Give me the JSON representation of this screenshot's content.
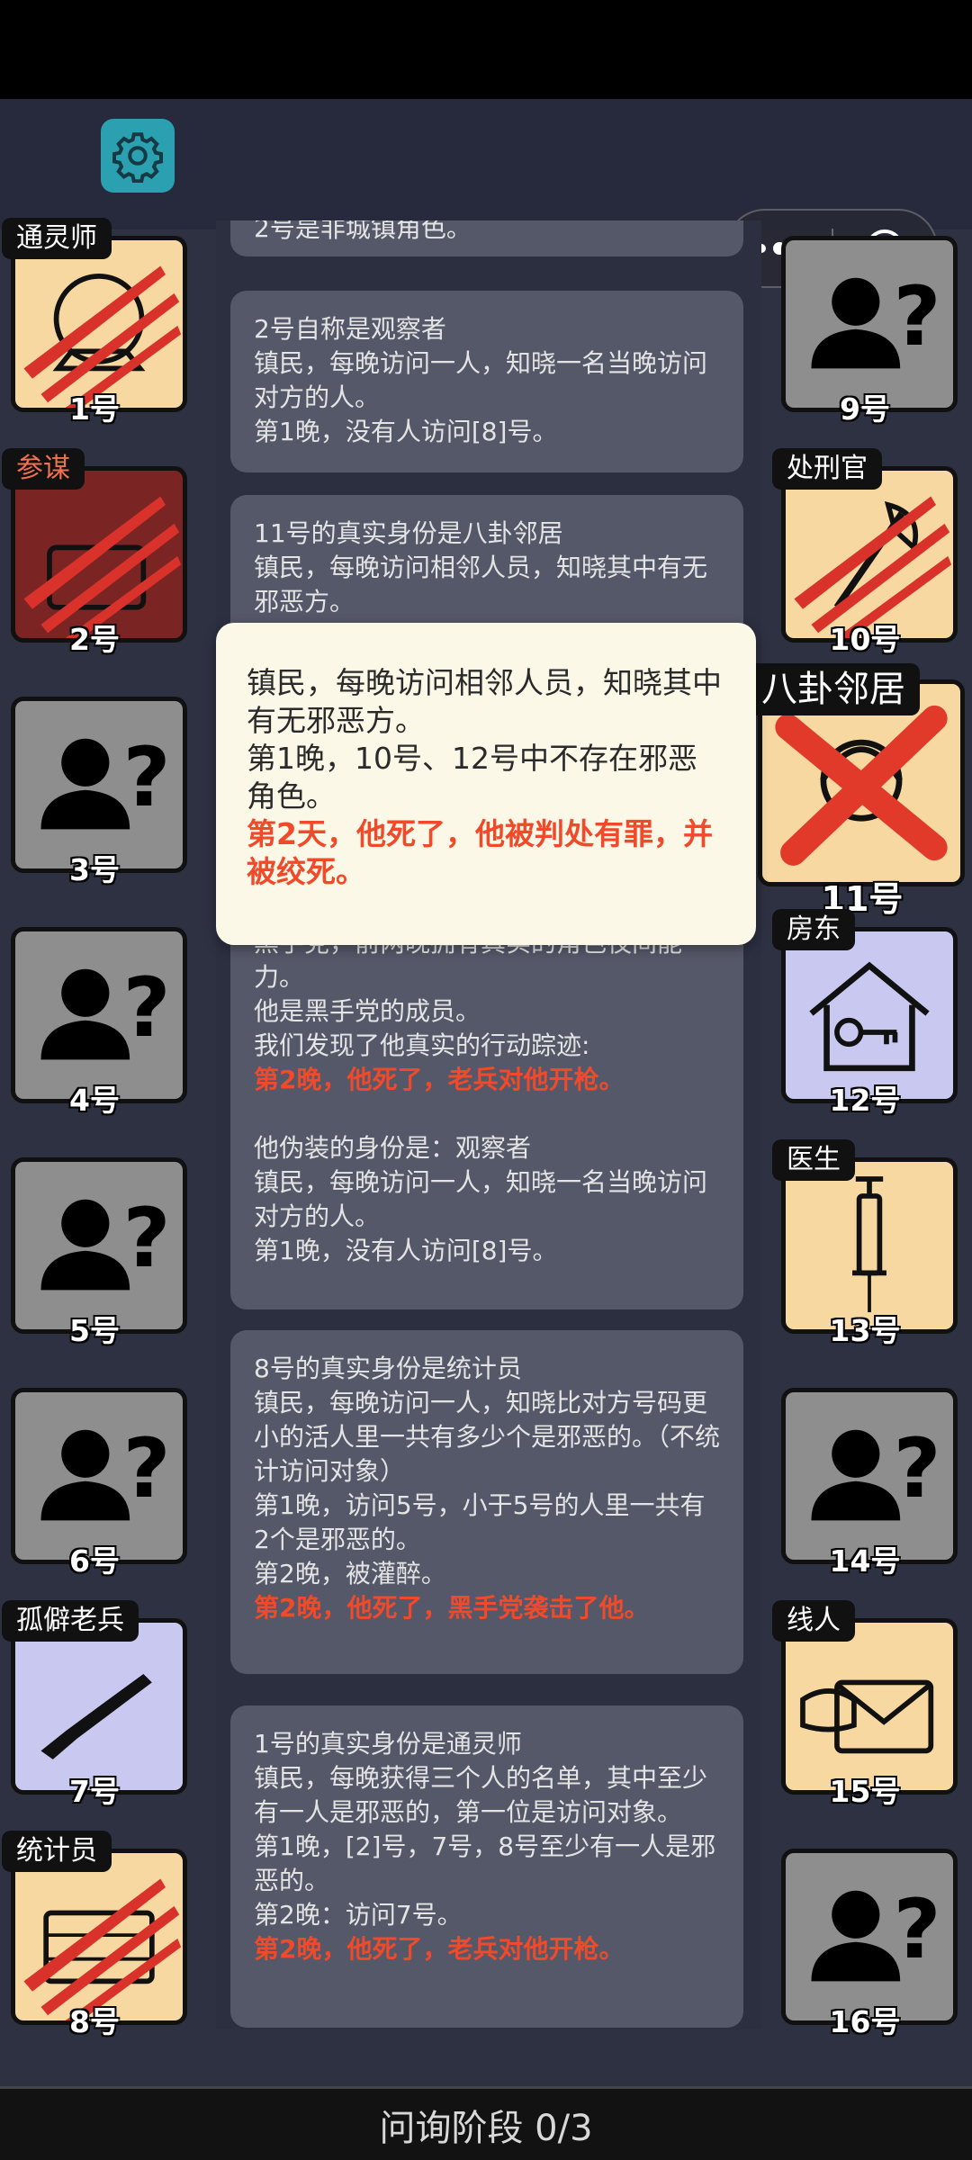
{
  "phase_label": "问询阶段 0/3",
  "popup": {
    "lines": [
      "镇民，每晚访问相邻人员，知晓其中有无邪恶方。",
      "第1晚，10号、12号中不存在邪恶角色。"
    ],
    "death": "第2天，他死了，他被判处有罪，并被绞死。"
  },
  "log": {
    "card0": "2号是非城镇角色。",
    "card1": [
      "2号自称是观察者",
      "镇民，每晚访问一人，知晓一名当晚访问对方的人。",
      "第1晚，没有人访问[8]号。"
    ],
    "card2": [
      "11号的真实身份是八卦邻居",
      "镇民，每晚访问相邻人员，知晓其中有无邪恶方。"
    ],
    "card3": {
      "lines": [
        "黑手党，前两晚拥有真实的角色夜间能力。",
        "他是黑手党的成员。",
        "我们发现了他真实的行动踪迹:"
      ],
      "death": "第2晚，他死了，老兵对他开枪。",
      "lines2": [
        "他伪装的身份是：观察者",
        "镇民，每晚访问一人，知晓一名当晚访问对方的人。",
        "第1晚，没有人访问[8]号。"
      ]
    },
    "card4": {
      "lines": [
        "8号的真实身份是统计员",
        "镇民，每晚访问一人，知晓比对方号码更小的活人里一共有多少个是邪恶的。（不统计访问对象）",
        "第1晚，访问5号，小于5号的人里一共有2个是邪恶的。",
        "第2晚，被灌醉。"
      ],
      "death": "第2晚，他死了，黑手党袭击了他。"
    },
    "card5": {
      "lines": [
        "1号的真实身份是通灵师",
        "镇民，每晚获得三个人的名单，其中至少有一人是邪恶的，第一位是访问对象。",
        "第1晚，[2]号，7号，8号至少有一人是邪恶的。",
        "第2晚：访问7号。"
      ],
      "death": "第2晚，他死了，老兵对他开枪。"
    }
  },
  "players_left": [
    {
      "num": "1号",
      "role": "通灵师",
      "icon": "crystal-ball-icon",
      "dead": true
    },
    {
      "num": "2号",
      "role": "参谋",
      "icon": "briefcase-icon",
      "dead": true
    },
    {
      "num": "3号",
      "role": "",
      "icon": "unknown-person-icon",
      "dead": false
    },
    {
      "num": "4号",
      "role": "",
      "icon": "unknown-person-icon",
      "dead": false
    },
    {
      "num": "5号",
      "role": "",
      "icon": "unknown-person-icon",
      "dead": false
    },
    {
      "num": "6号",
      "role": "",
      "icon": "unknown-person-icon",
      "dead": false
    },
    {
      "num": "7号",
      "role": "孤僻老兵",
      "icon": "rifle-icon",
      "dead": false
    },
    {
      "num": "8号",
      "role": "统计员",
      "icon": "abacus-icon",
      "dead": true
    }
  ],
  "players_right": [
    {
      "num": "9号",
      "role": "",
      "icon": "unknown-person-icon",
      "dead": false
    },
    {
      "num": "10号",
      "role": "处刑官",
      "icon": "axe-icon",
      "dead": true
    },
    {
      "num": "11号",
      "role": "八卦邻居",
      "icon": "gossip-icon",
      "dead": true
    },
    {
      "num": "12号",
      "role": "房东",
      "icon": "house-key-icon",
      "dead": false
    },
    {
      "num": "13号",
      "role": "医生",
      "icon": "syringe-icon",
      "dead": false
    },
    {
      "num": "14号",
      "role": "",
      "icon": "unknown-person-icon",
      "dead": false
    },
    {
      "num": "15号",
      "role": "线人",
      "icon": "envelope-icon",
      "dead": false
    },
    {
      "num": "16号",
      "role": "",
      "icon": "unknown-person-icon",
      "dead": false
    }
  ]
}
